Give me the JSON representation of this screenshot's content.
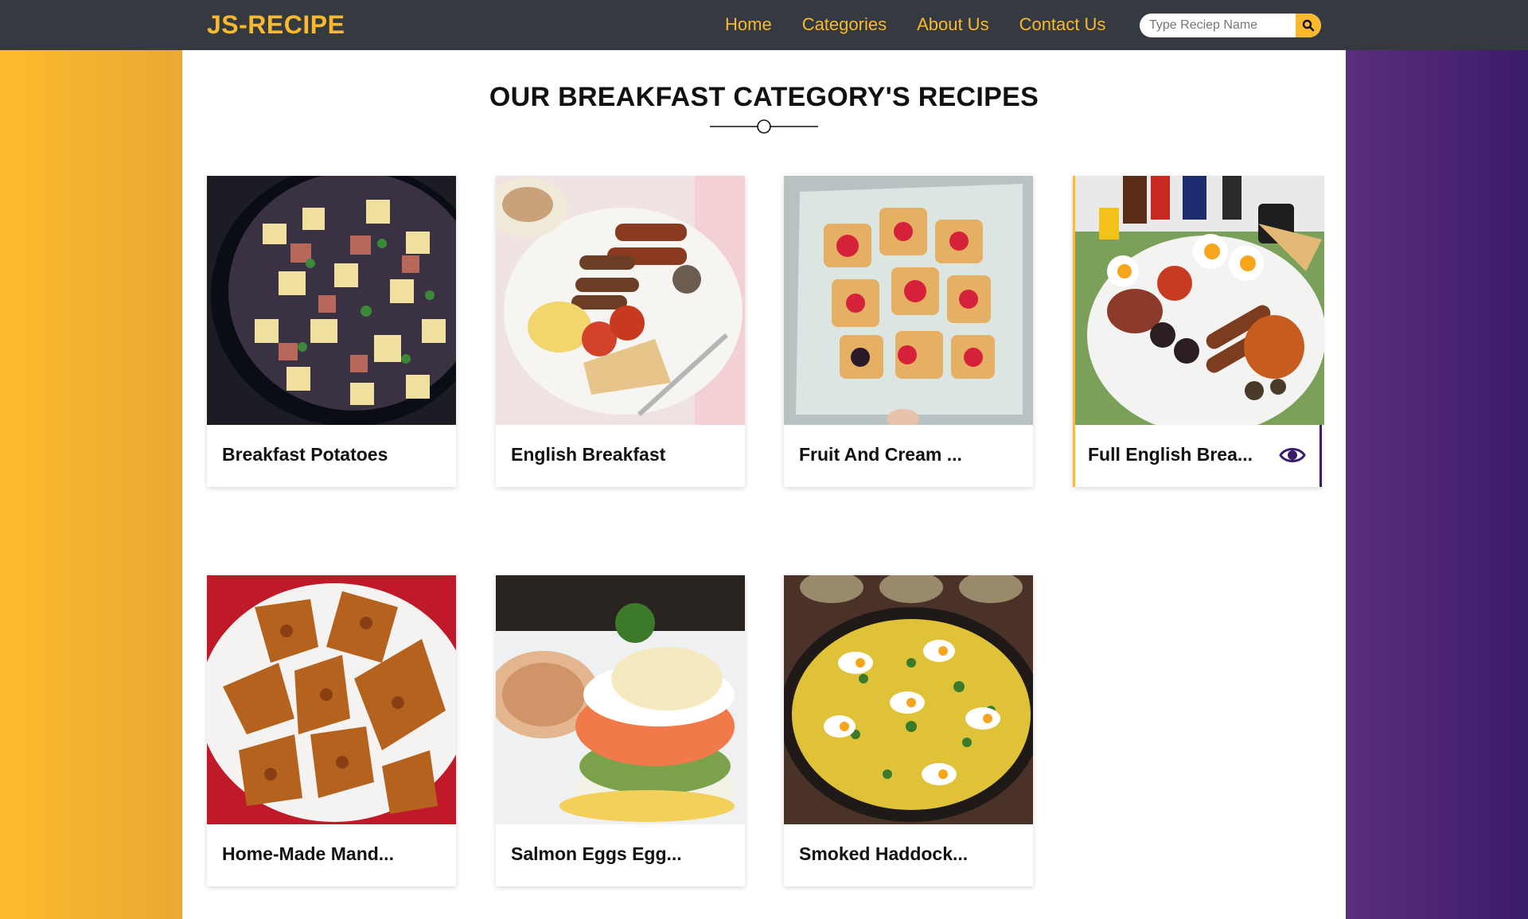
{
  "brand": "JS-RECIPE",
  "nav": [
    "Home",
    "Categories",
    "About Us",
    "Contact Us"
  ],
  "search": {
    "placeholder": "Type Reciep Name"
  },
  "page_title": "OUR BREAKFAST CATEGORY'S RECIPES",
  "colors": {
    "accent": "#f9b82e",
    "navbar": "#343a40",
    "purple": "#3c1b6b"
  },
  "recipes": [
    {
      "name": "Breakfast Potatoes"
    },
    {
      "name": "English Breakfast"
    },
    {
      "name": "Fruit And Cream ..."
    },
    {
      "name": "Full English Brea..."
    },
    {
      "name": "Home-Made Mand..."
    },
    {
      "name": "Salmon Eggs Egg..."
    },
    {
      "name": "Smoked Haddock..."
    }
  ]
}
